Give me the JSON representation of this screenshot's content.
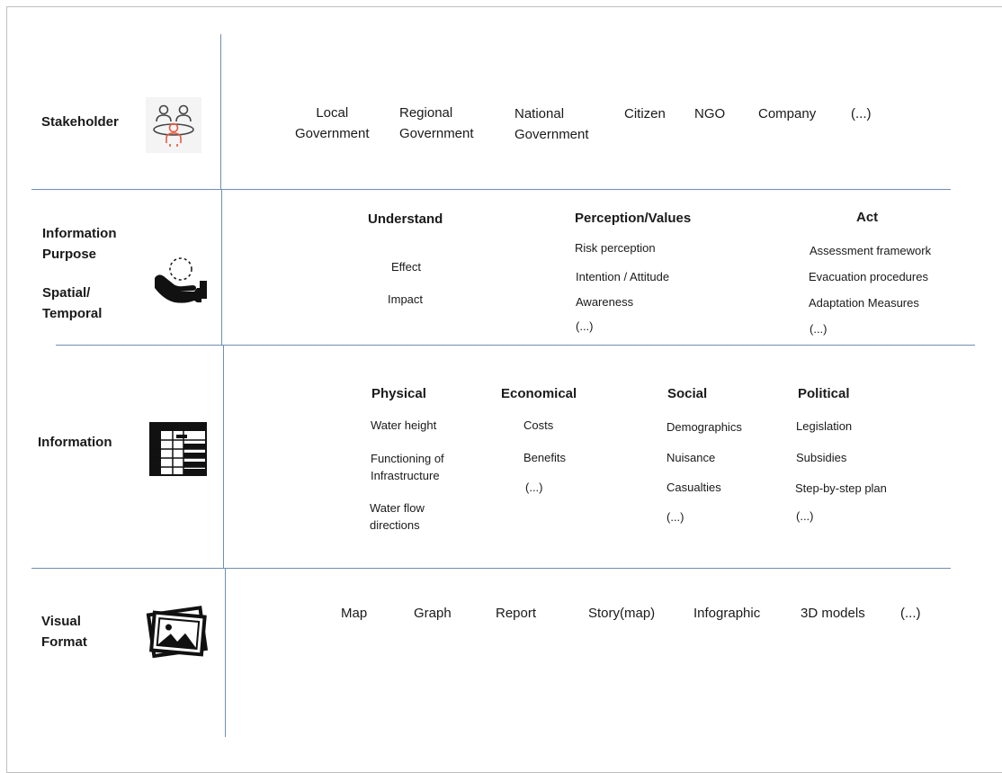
{
  "rows": {
    "stakeholder": {
      "label": "Stakeholder",
      "items": [
        "Local\nGovernment",
        "Regional\nGovernment",
        "National\nGovernment",
        "Citizen",
        "NGO",
        "Company",
        "(...)"
      ]
    },
    "purpose": {
      "label": "Information\nPurpose",
      "label2": "Spatial/\nTemporal",
      "columns": [
        {
          "header": "Understand",
          "items": [
            "Effect",
            "Impact"
          ]
        },
        {
          "header": "Perception/Values",
          "items": [
            "Risk perception",
            "Intention / Attitude",
            "Awareness",
            "(...)"
          ]
        },
        {
          "header": "Act",
          "items": [
            "Assessment framework",
            "Evacuation procedures",
            "Adaptation Measures",
            "(...)"
          ]
        }
      ]
    },
    "information": {
      "label": "Information",
      "columns": [
        {
          "header": "Physical",
          "items": [
            "Water height",
            "Functioning of\nInfrastructure",
            "Water flow\ndirections"
          ]
        },
        {
          "header": "Economical",
          "items": [
            "Costs",
            "Benefits",
            "(...)"
          ]
        },
        {
          "header": "Social",
          "items": [
            "Demographics",
            "Nuisance",
            "Casualties",
            "(...)"
          ]
        },
        {
          "header": "Political",
          "items": [
            "Legislation",
            "Subsidies",
            "Step-by-step plan",
            "(...)"
          ]
        }
      ]
    },
    "format": {
      "label": "Visual\nFormat",
      "items": [
        "Map",
        "Graph",
        "Report",
        "Story(map)",
        "Infographic",
        "3D models",
        "(...)"
      ]
    }
  },
  "icons": {
    "stakeholder": "people-meeting-icon",
    "purpose": "hand-holding-icon",
    "information": "table-icon",
    "format": "photo-gallery-icon"
  },
  "colors": {
    "line": "#6f8fb3",
    "accent": "#e8593c"
  }
}
